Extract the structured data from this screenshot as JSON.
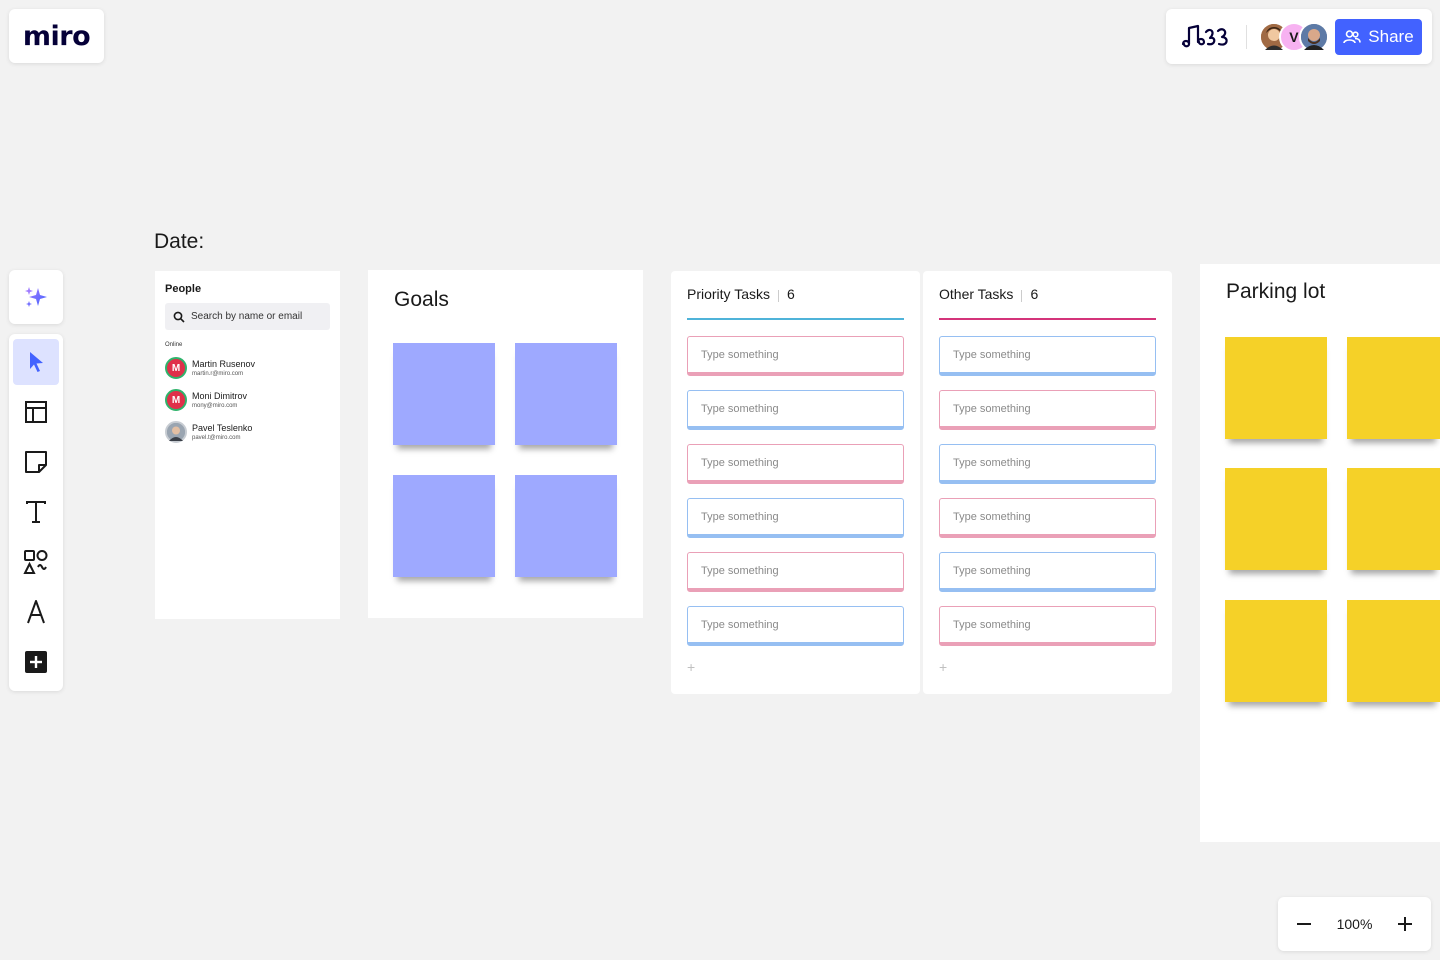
{
  "app": {
    "logo_text": "miro"
  },
  "topbar": {
    "reactions_icon": "doodle-reactions-icon",
    "avatars": [
      {
        "name": "avatar-photo-1",
        "initial": ""
      },
      {
        "name": "avatar-v",
        "initial": "V"
      },
      {
        "name": "avatar-photo-2",
        "initial": ""
      }
    ],
    "share_label": "Share",
    "share_color": "#4262ff"
  },
  "toolbar": {
    "tools": [
      "ai-sparkle",
      "select",
      "templates",
      "sticky-note",
      "text",
      "shapes",
      "pen",
      "add"
    ]
  },
  "zoom": {
    "level": "100%",
    "minus": "−",
    "plus": "+"
  },
  "board": {
    "date_label": "Date:",
    "people": {
      "title": "People",
      "search_placeholder": "Search by name or email",
      "online_label": "Online",
      "members": [
        {
          "initial": "M",
          "name": "Martin Rusenov",
          "email": "martin.r@miro.com"
        },
        {
          "initial": "M",
          "name": "Moni Dimitrov",
          "email": "mony@miro.com"
        },
        {
          "initial": "",
          "name": "Pavel Teslenko",
          "email": "pavel.t@miro.com"
        }
      ]
    },
    "goals": {
      "title": "Goals",
      "sticky_color": "#9ea9ff",
      "sticky_count": 4
    },
    "priority_tasks": {
      "title": "Priority Tasks",
      "count": "6",
      "line_color": "#4fb3d9",
      "cards": [
        {
          "text": "Type something",
          "color": "pink"
        },
        {
          "text": "Type something",
          "color": "blue"
        },
        {
          "text": "Type something",
          "color": "pink"
        },
        {
          "text": "Type something",
          "color": "blue"
        },
        {
          "text": "Type something",
          "color": "pink"
        },
        {
          "text": "Type something",
          "color": "blue"
        }
      ],
      "add_label": "+"
    },
    "other_tasks": {
      "title": "Other Tasks",
      "count": "6",
      "line_color": "#d4347a",
      "cards": [
        {
          "text": "Type something",
          "color": "blue"
        },
        {
          "text": "Type something",
          "color": "pink"
        },
        {
          "text": "Type something",
          "color": "blue"
        },
        {
          "text": "Type something",
          "color": "pink"
        },
        {
          "text": "Type something",
          "color": "blue"
        },
        {
          "text": "Type something",
          "color": "pink"
        }
      ],
      "add_label": "+"
    },
    "parking_lot": {
      "title": "Parking lot",
      "sticky_color": "#f5d128",
      "sticky_count": 6
    }
  }
}
